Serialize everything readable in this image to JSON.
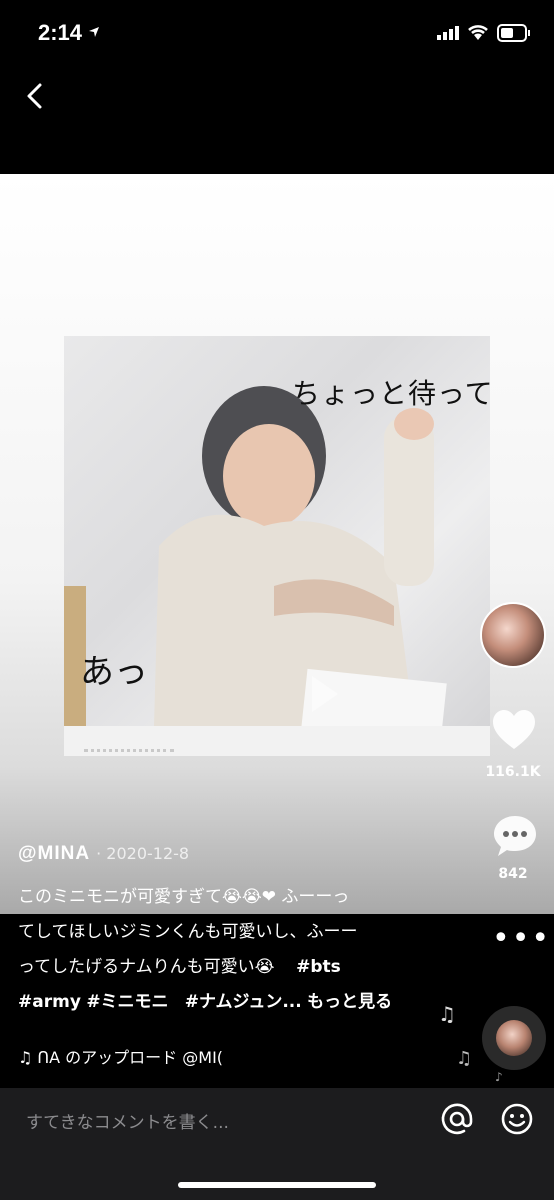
{
  "status_bar": {
    "time": "2:14"
  },
  "video": {
    "overlay_text_1": "ちょっと待って",
    "overlay_text_2": "あっ"
  },
  "actions": {
    "likes": "116.1K",
    "comments": "842",
    "more": "•••"
  },
  "post": {
    "author": "@MINA",
    "date": "· 2020-12-8",
    "desc_line1": "このミニモニが可愛すぎて😭😭❤ ふーーっ",
    "desc_line2": "てしてほしいジミンくんも可愛いし、ふーー",
    "desc_line3a": "ってしたげるナムりんも可愛い😭",
    "tag_bts": "#bts",
    "tag_army": "#army",
    "tag_minimoni": "#ミニモニ",
    "tag_namjoon": "#ナムジュン...",
    "see_more": "もっと見る",
    "music_text": "♫  ᑎA のアップロード    @MI("
  },
  "comment_bar": {
    "placeholder": "すてきなコメントを書く..."
  }
}
